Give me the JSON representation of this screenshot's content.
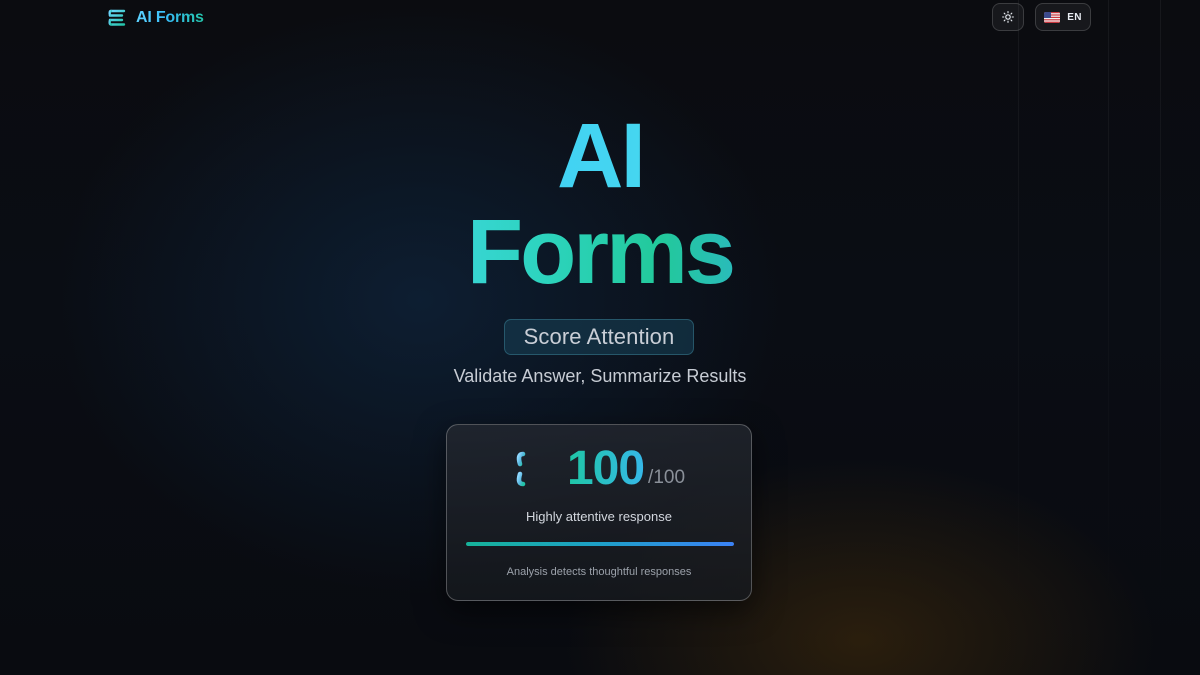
{
  "header": {
    "brand_name": "AI Forms",
    "brand_icon": "stacked-lines-logo",
    "theme_toggle_icon": "sun-icon",
    "language": {
      "flag_icon": "us-flag-icon",
      "label": "EN"
    }
  },
  "hero": {
    "title_line1": "AI",
    "title_line2": "Forms",
    "badge": "Score Attention",
    "subtitle": "Validate Answer, Summarize Results"
  },
  "score_card": {
    "icon": "stacked-lines-logo",
    "score": "100",
    "max": "/100",
    "status": "Highly attentive response",
    "progress_fraction": 1.0,
    "caption": "Analysis detects thoughtful responses"
  },
  "colors": {
    "background": "#0a0c12",
    "accent_cyan": "#38bdf8",
    "accent_teal": "#22c49f",
    "accent_blue": "#3b82f6"
  }
}
